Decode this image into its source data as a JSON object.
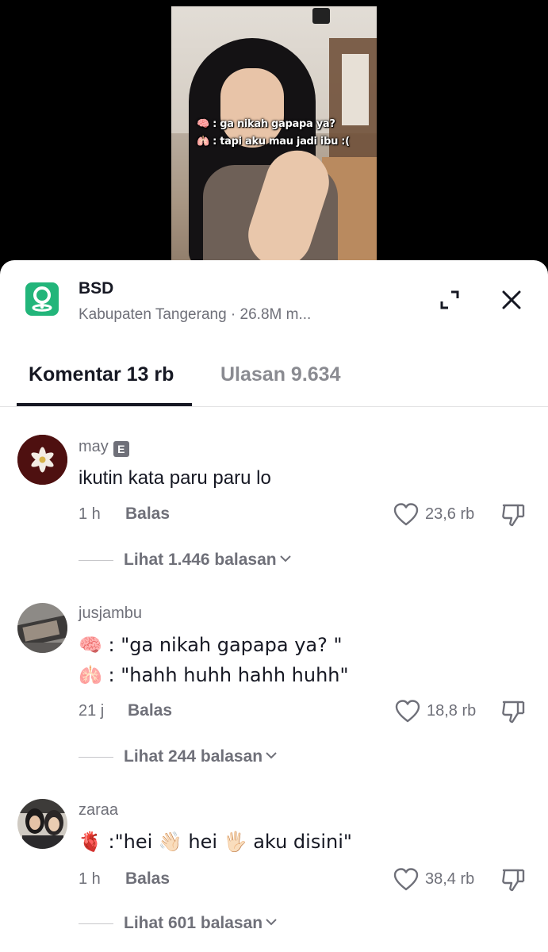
{
  "video": {
    "caption_line1": "🧠 : ga nikah gapapa ya?",
    "caption_line2": "🫁 : tapi aku mau jadi ibu :("
  },
  "place": {
    "icon": "map-pin-icon",
    "title": "BSD",
    "subtitle": "Kabupaten Tangerang · 26.8M m..."
  },
  "header_actions": {
    "expand_icon": "expand-icon",
    "close_icon": "close-icon"
  },
  "tabs": [
    {
      "label": "Komentar 13 rb",
      "active": true
    },
    {
      "label": "Ulasan 9.634",
      "active": false
    }
  ],
  "comments": [
    {
      "username": "may",
      "badge": "E",
      "lines": [
        "ikutin kata paru paru lo"
      ],
      "time": "1 h",
      "reply_label": "Balas",
      "likes": "23,6 rb",
      "view_replies": "Lihat 1.446 balasan"
    },
    {
      "username": "jusjambu",
      "lines": [
        "🧠 : \"ga nikah gapapa ya? \"",
        "🫁 : \"hahh huhh hahh huhh\""
      ],
      "time": "21 j",
      "reply_label": "Balas",
      "likes": "18,8 rb",
      "view_replies": "Lihat 244 balasan"
    },
    {
      "username": "zaraa",
      "lines": [
        "🫀 :\"hei 👋🏻 hei 🖐🏻 aku disini\""
      ],
      "time": "1 h",
      "reply_label": "Balas",
      "likes": "38,4 rb",
      "view_replies": "Lihat 601 balasan"
    }
  ],
  "colors": {
    "accent_place": "#22b57a",
    "text_primary": "#161823",
    "text_secondary": "#6f7079"
  }
}
